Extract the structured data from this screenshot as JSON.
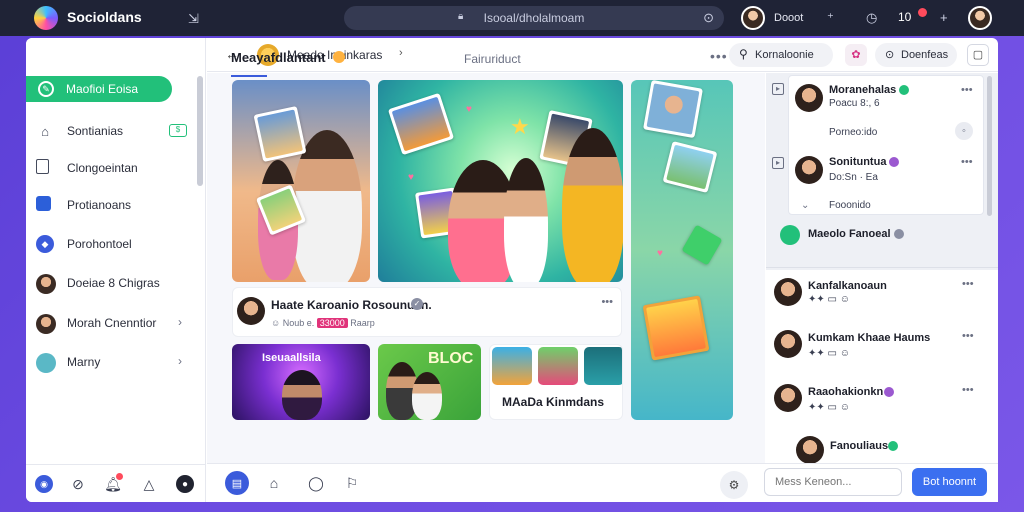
{
  "app": {
    "title": "Socioldans"
  },
  "address_bar": {
    "url": "Isooal/dholalmoam"
  },
  "topbar": {
    "user_name": "Dooot",
    "count": "10"
  },
  "sidebar": {
    "primary": {
      "label": "Maofioi Eoisa"
    },
    "items": [
      {
        "label": "Sontianias",
        "badge": "$"
      },
      {
        "label": "Clongoeintan"
      },
      {
        "label": "Protianoans"
      },
      {
        "label": "Porohontoel"
      },
      {
        "label": "Doeiae 8 Chigras"
      },
      {
        "label": "Morah Cnenntior"
      },
      {
        "label": "Marny"
      }
    ]
  },
  "header": {
    "title": "Meado Inoinkaras",
    "search_label": "Kornaloonie",
    "chip_label": "Doenfeas"
  },
  "feed": {
    "title": "Meayafdlantant",
    "tab": "Fairuriduct",
    "post": {
      "name": "Haate Karoanio Rosounuan.",
      "meta_prefix": "Noub e.",
      "meta_highlight": "33000",
      "meta_suffix": "Raarp"
    },
    "tiles": [
      {
        "title": "Iseuaallsila"
      },
      {
        "title": "BLOC"
      },
      {
        "title": "MAaDa Kinmdans"
      }
    ]
  },
  "right_panel": {
    "users": [
      {
        "name": "Moranehalas",
        "sub": "Poacu 8:, 6",
        "sub2": "Porneo:ido"
      },
      {
        "name": "Sonituntua",
        "sub": "Do:Sn · Ea",
        "sub2": "Fooonido"
      },
      {
        "name": "Maeolo Fanoeal"
      },
      {
        "name": "Kanfalkanoaun"
      },
      {
        "name": "Kumkam Khaae Haums"
      },
      {
        "name": "Raaohakionkn"
      },
      {
        "name": "Fanouliaus"
      }
    ]
  },
  "bottombar": {
    "message_placeholder": "Mess Keneon...",
    "send_label": "Bot hoonnt"
  }
}
